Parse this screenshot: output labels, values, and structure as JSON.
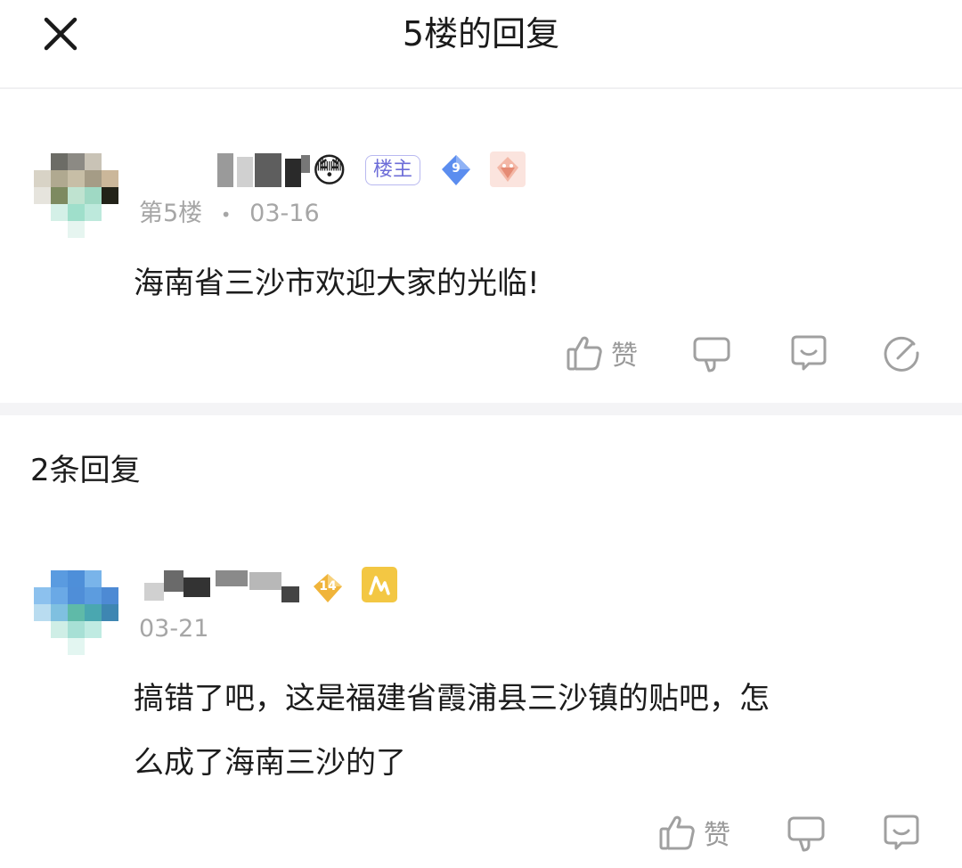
{
  "header": {
    "title": "5楼的回复",
    "close_icon": "close-icon"
  },
  "floor_post": {
    "username_display": "[pixelated]",
    "emoji": "😳",
    "op_badge": "楼主",
    "level": "9",
    "floor_label": "第5楼",
    "separator": "•",
    "date": "03-16",
    "content": "海南省三沙市欢迎大家的光临!",
    "actions": {
      "like_label": "赞",
      "like_icon": "thumbs-up-icon",
      "dislike_icon": "thumbs-down-icon",
      "comment_icon": "comment-icon",
      "share_icon": "edit-icon"
    }
  },
  "replies": {
    "heading": "2条回复",
    "items": [
      {
        "username_display": "[pixelated]",
        "level": "14",
        "date": "03-21",
        "content_line1": "搞错了吧，这是福建省霞浦县三沙镇的贴吧，怎",
        "content_line2": "么成了海南三沙的了",
        "actions": {
          "like_label": "赞",
          "like_icon": "thumbs-up-icon",
          "dislike_icon": "thumbs-down-icon",
          "comment_icon": "comment-icon"
        }
      }
    ]
  },
  "colors": {
    "op_badge": "#6d6dd8",
    "level_blue": "#5b8def",
    "level_gold": "#f0b43a",
    "meta_gray": "#a6a6a6"
  }
}
